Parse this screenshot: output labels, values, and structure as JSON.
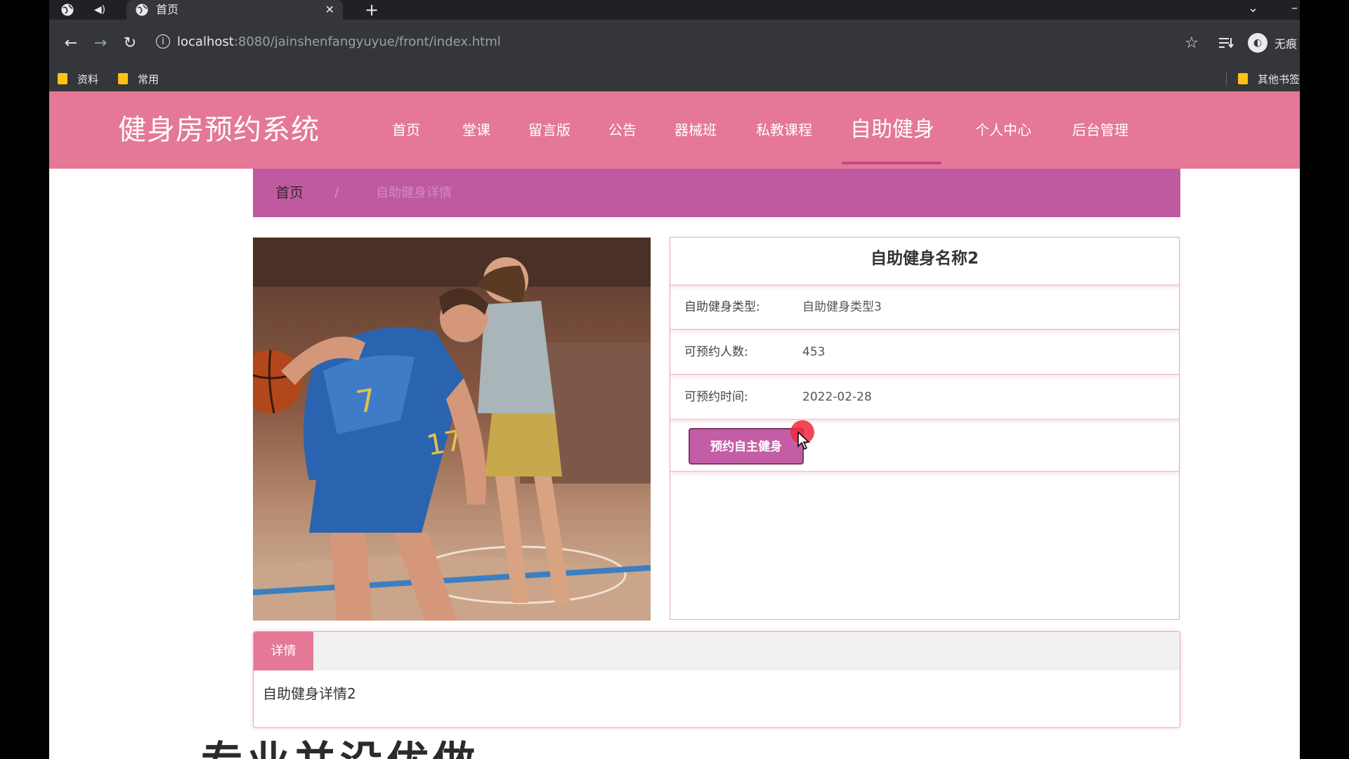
{
  "browser": {
    "tab_title": "首页",
    "url_host": "localhost",
    "url_path": ":8080/jainshenfangyuyue/front/index.html",
    "profile_label": "无痕",
    "bookmarks": [
      "资料",
      "常用"
    ],
    "other_bookmarks": "其他书签"
  },
  "site": {
    "logo": "健身房预约系统",
    "nav": [
      "首页",
      "堂课",
      "留言版",
      "公告",
      "器械班",
      "私教课程",
      "自助健身",
      "个人中心",
      "后台管理"
    ],
    "active_nav": "自助健身"
  },
  "breadcrumb": {
    "home": "首页",
    "separator": "/",
    "current": "自助健身详情"
  },
  "item": {
    "name": "自助健身名称2",
    "fields": [
      {
        "label": "自助健身类型:",
        "value": "自助健身类型3"
      },
      {
        "label": "可预约人数:",
        "value": "453"
      },
      {
        "label": "可预约时间:",
        "value": "2022-02-28"
      }
    ],
    "book_button": "预约自主健身"
  },
  "detail": {
    "tab": "详情",
    "content": "自助健身详情2"
  },
  "banner_text": "专业并没优做",
  "colors": {
    "header": "#e47896",
    "breadcrumb": "#c05aa0",
    "button": "#c35ea6"
  }
}
